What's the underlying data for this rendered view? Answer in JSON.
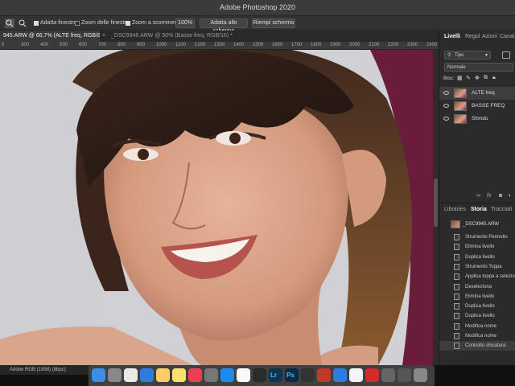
{
  "window": {
    "title": "Adobe Photoshop 2020"
  },
  "options_bar": {
    "fit_windows": "Adatta finestre",
    "zoom_all_windows": "Zoom delle finestre",
    "scrubby_zoom": "Zoom a scorrimento",
    "percent_btn": "100%",
    "fit_screen_btn": "Adatta allo schermo",
    "fill_screen_btn": "Riempi schermo"
  },
  "tabs": [
    {
      "label": "945.ARW @ 66,7% (ALTE freq, RGB/8) *"
    },
    {
      "label": "_DSC9946.ARW @ 50% (Basse freq, RGB/16) *"
    }
  ],
  "ruler": {
    "ticks": [
      "0",
      "300",
      "400",
      "500",
      "600",
      "700",
      "800",
      "900",
      "1000",
      "1100",
      "1200",
      "1300",
      "1400",
      "1500",
      "1600",
      "1700",
      "1800",
      "1900",
      "2000",
      "2100",
      "2200",
      "2300",
      "2400"
    ]
  },
  "layers_panel": {
    "tabs": [
      "Livelli",
      "Regol",
      "Azioni",
      "Canal"
    ],
    "kind_filter": "Tipo",
    "blend_mode": "Normale",
    "lock_label": "Bloc:",
    "layers": [
      {
        "name": "ALTE freq",
        "selected": true
      },
      {
        "name": "BASSE FREQ",
        "selected": false
      },
      {
        "name": "Sfondo",
        "selected": false
      }
    ]
  },
  "history_panel": {
    "tabs": [
      "Libraries",
      "Storia",
      "Tracciati"
    ],
    "snapshot": "_DSC9945.ARW",
    "items": [
      "Strumento Pennello",
      "Elimina livello",
      "Duplica livello",
      "Strumento Toppa",
      "Applica toppa a selezione",
      "Deseleziona",
      "Elimina livello",
      "Duplica livello",
      "Duplica livello",
      "Modifica nome",
      "Modifica nome",
      "Controllo sfocatura"
    ],
    "selected_index": 11
  },
  "status_bar": {
    "text": "Adobe RGB (1998) (8bpc)"
  },
  "dock": {
    "icons": [
      "finder-icon",
      "launchpad-icon",
      "photos-icon",
      "safari-icon",
      "preview-icon",
      "notes-icon",
      "music-icon",
      "system-preferences-icon",
      "app-store-icon",
      "calendar-icon",
      "activity-icon",
      "lightroom-icon",
      "photoshop-icon",
      "app-icon",
      "app-icon-2",
      "chrome-icon",
      "textedit-icon",
      "acrobat-icon",
      "help-icon",
      "utility-icon",
      "trash-icon"
    ],
    "lr_label": "Lr",
    "ps_label": "Ps"
  }
}
